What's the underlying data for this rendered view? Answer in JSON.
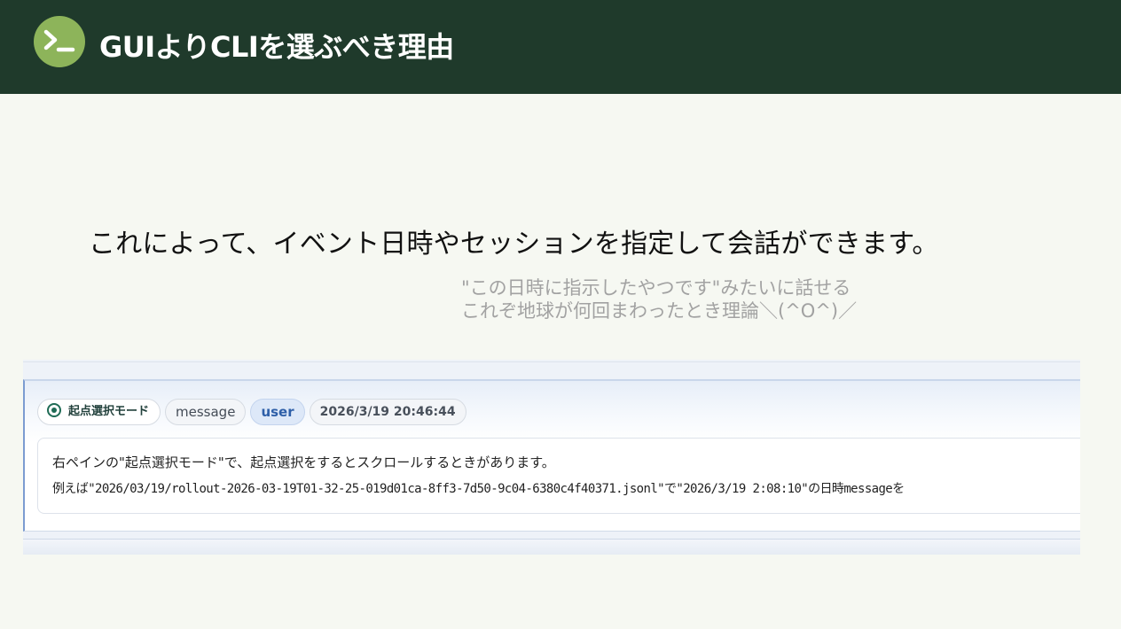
{
  "header": {
    "title": "GUIよりCLIを選ぶべき理由",
    "logo_icon": "terminal-prompt-icon",
    "background": "#1f3a2b",
    "logo_color": "#8db45a"
  },
  "main": {
    "text": "これによって、イベント日時やセッションを指定して会話ができます。",
    "sub_line1": "\"この日時に指示したやつです\"みたいに話せる",
    "sub_line2": "これぞ地球が何回まわったとき理論＼(^O^)／"
  },
  "screenshot": {
    "mode_chip": "起点選択モード",
    "type_chip": "message",
    "role_chip": "user",
    "time_chip": "2026/3/19 20:46:44",
    "message_line1": "右ペインの\"起点選択モード\"で、起点選択をするとスクロールするときがあります。",
    "message_line2": "例えば\"2026/03/19/rollout-2026-03-19T01-32-25-019d01ca-8ff3-7d50-9c04-6380c4f40371.jsonl\"で\"2026/3/19 2:08:10\"の日時messageを"
  }
}
